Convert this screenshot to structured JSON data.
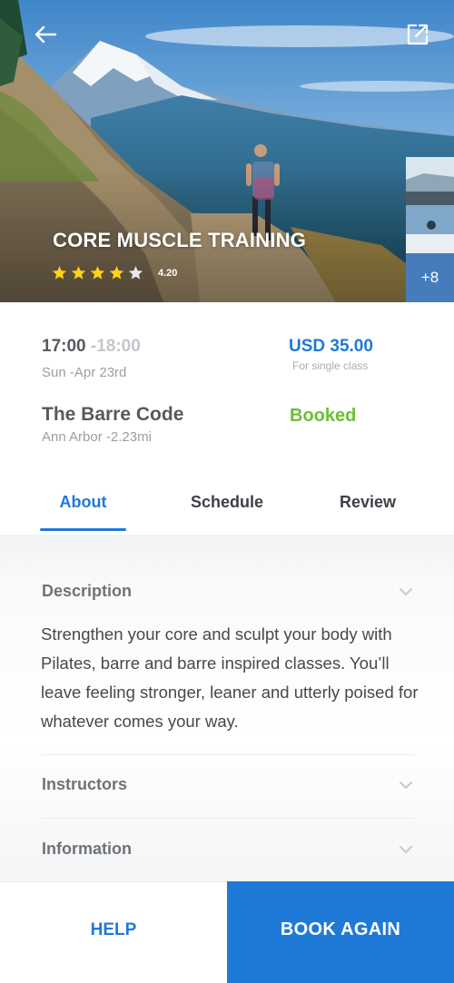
{
  "hero": {
    "title": "CORE MUSCLE TRAINING",
    "rating": "4.20",
    "stars_filled": 4,
    "stars_total": 5,
    "more_photos": "+8",
    "back_icon": "arrow-left-icon",
    "share_icon": "external-link-icon"
  },
  "class": {
    "time_start": "17:00",
    "time_end": "-18:00",
    "date": "Sun -Apr 23rd",
    "price": "USD 35.00",
    "price_note": "For single class",
    "studio": "The Barre Code",
    "location": "Ann Arbor -2.23mi",
    "status": "Booked"
  },
  "tabs": [
    {
      "label": "About",
      "active": true
    },
    {
      "label": "Schedule",
      "active": false
    },
    {
      "label": "Review",
      "active": false
    }
  ],
  "sections": {
    "description": {
      "title": "Description",
      "text": "Strengthen your core and sculpt your body with Pilates, barre and barre inspired classes. You’ll leave feeling stronger, leaner and utterly poised for whatever comes your way."
    },
    "instructors": {
      "title": "Instructors"
    },
    "information": {
      "title": "Information"
    }
  },
  "actions": {
    "help": "HELP",
    "book_again": "BOOK AGAIN"
  },
  "colors": {
    "accent": "#1f79d6",
    "status_booked": "#6cbf35",
    "star": "#ffd21a"
  }
}
